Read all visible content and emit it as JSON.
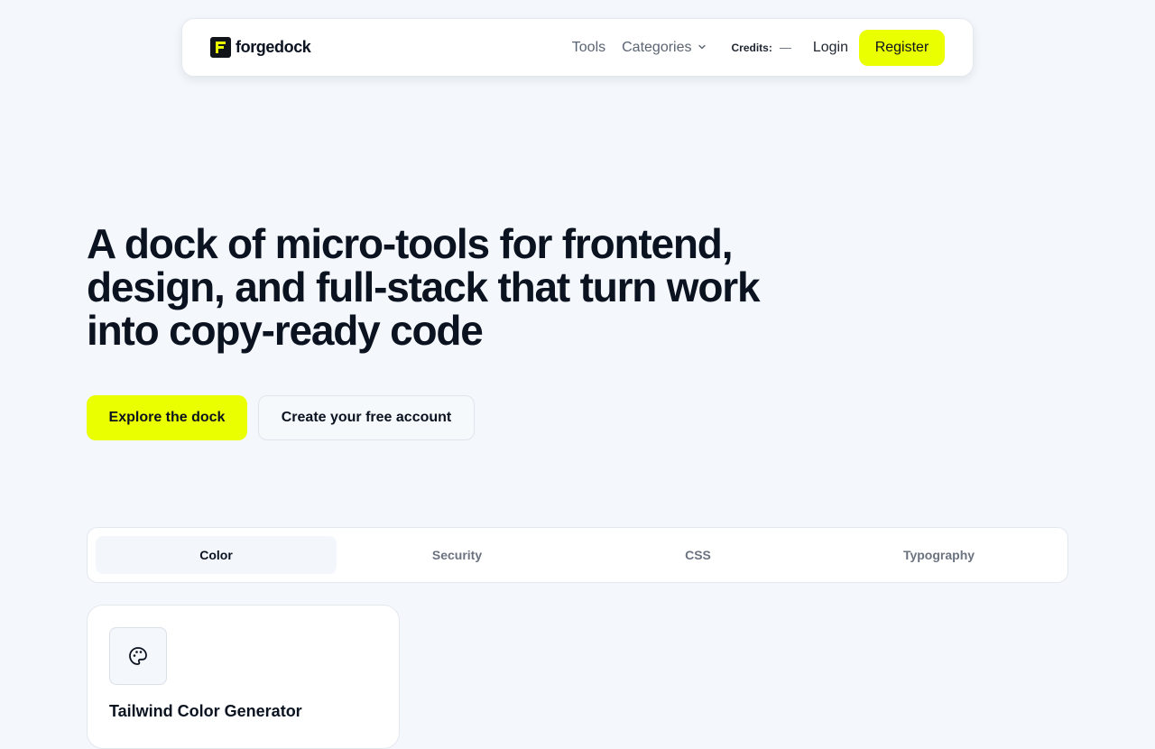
{
  "nav": {
    "brand": "forgedock",
    "tools": "Tools",
    "categories": "Categories",
    "credits_label": "Credits:",
    "credits_value": "—",
    "login": "Login",
    "register": "Register"
  },
  "hero": {
    "title": "A dock of micro-tools for frontend, design, and full-stack that turn work into copy-ready code",
    "primary_cta": "Explore the dock",
    "secondary_cta": "Create your free account"
  },
  "tabs": [
    {
      "label": "Color",
      "active": true
    },
    {
      "label": "Security",
      "active": false
    },
    {
      "label": "CSS",
      "active": false
    },
    {
      "label": "Typography",
      "active": false
    }
  ],
  "cards": [
    {
      "title": "Tailwind Color Generator",
      "icon": "palette-icon"
    }
  ],
  "colors": {
    "accent": "#eaff00",
    "background": "#f4f8fc",
    "text": "#0b1220",
    "muted": "#5b6472"
  }
}
